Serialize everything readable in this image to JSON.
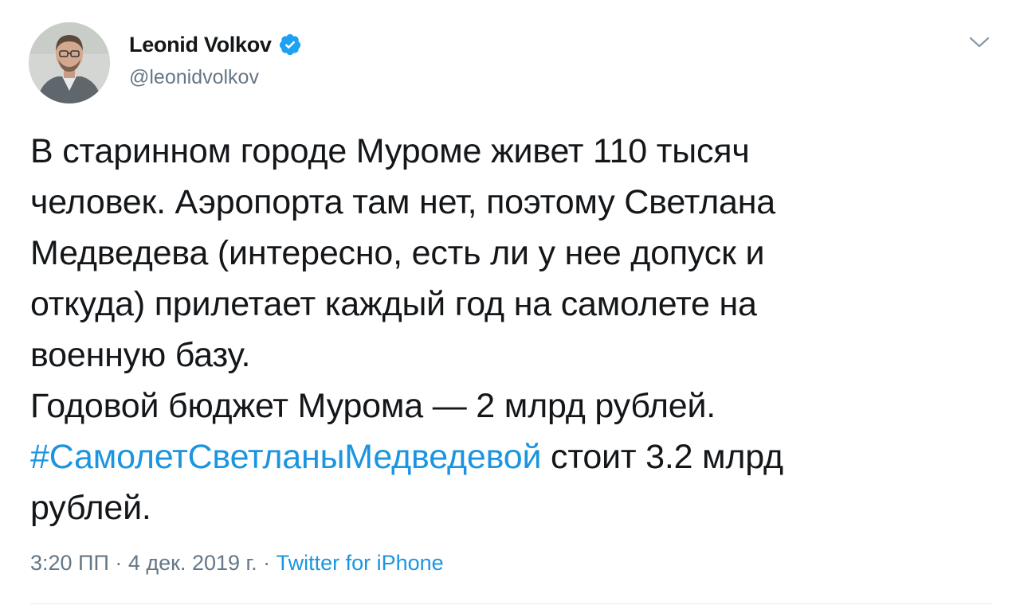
{
  "author": {
    "display_name": "Leonid Volkov",
    "handle": "@leonidvolkov",
    "verified": true,
    "avatar_icon": "profile-photo"
  },
  "tweet": {
    "lines": [
      "В старинном городе Муроме живет 110 тысяч",
      "человек. Аэропорта там нет, поэтому Светлана",
      "Медведева (интересно, есть ли у нее допуск и",
      "откуда) прилетает каждый год на самолете на",
      "военную базу.",
      "Годовой бюджет Мурома — 2 млрд рублей."
    ],
    "hashtag": "#СамолетСветланыМедведевой",
    "after_hashtag": " стоит 3.2 млрд",
    "last_line": "рублей."
  },
  "meta": {
    "time": "3:20 ПП",
    "sep1": " · ",
    "date": "4 дек. 2019 г.",
    "sep2": " · ",
    "source": "Twitter for iPhone"
  },
  "colors": {
    "link": "#1b95e0",
    "text": "#14171a",
    "muted": "#657786"
  }
}
